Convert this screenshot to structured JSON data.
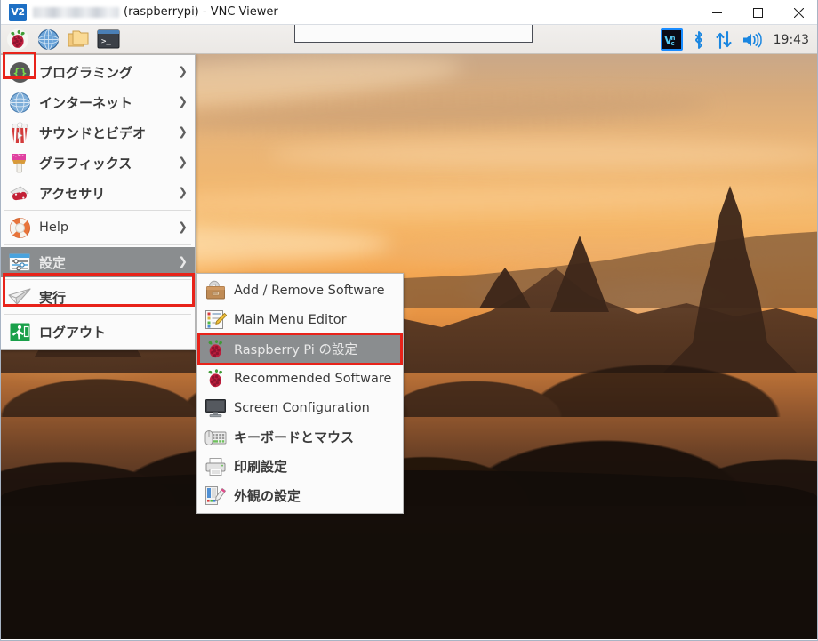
{
  "window": {
    "app_icon": "vnc-logo-icon",
    "app_icon_text": "V2",
    "host_redacted": "",
    "title": "(raspberrypi) - VNC Viewer",
    "minimize": "–",
    "maximize": "☐",
    "close": "×"
  },
  "taskbar": {
    "launchers": [
      {
        "name": "raspberry-menu-button",
        "icon": "raspberry-pi-icon"
      },
      {
        "name": "web-browser-button",
        "icon": "globe-icon"
      },
      {
        "name": "file-manager-button",
        "icon": "folders-icon"
      },
      {
        "name": "terminal-button",
        "icon": "terminal-icon"
      }
    ],
    "tray": [
      {
        "name": "vnc-server-tray-icon",
        "icon": "vnc-logo-icon",
        "label": "V2"
      },
      {
        "name": "bluetooth-tray-icon",
        "icon": "bluetooth-icon"
      },
      {
        "name": "network-tray-icon",
        "icon": "network-updown-icon"
      },
      {
        "name": "volume-tray-icon",
        "icon": "speaker-icon"
      }
    ],
    "clock": "19:43"
  },
  "menu": {
    "items": [
      {
        "label": "プログラミング",
        "icon": "braces-icon",
        "arrow": "❯",
        "lang": "ja",
        "selected": false
      },
      {
        "label": "インターネット",
        "icon": "globe-icon",
        "arrow": "❯",
        "lang": "ja",
        "selected": false
      },
      {
        "label": "サウンドとビデオ",
        "icon": "popcorn-icon",
        "arrow": "❯",
        "lang": "ja",
        "selected": false
      },
      {
        "label": "グラフィックス",
        "icon": "paintbrush-icon",
        "arrow": "❯",
        "lang": "ja",
        "selected": false
      },
      {
        "label": "アクセサリ",
        "icon": "swiss-knife-icon",
        "arrow": "❯",
        "lang": "ja",
        "selected": false
      },
      {
        "label": "Help",
        "icon": "lifebuoy-icon",
        "arrow": "❯",
        "lang": "en",
        "selected": false
      },
      {
        "label": "設定",
        "icon": "sliders-icon",
        "arrow": "❯",
        "lang": "ja",
        "selected": true
      },
      {
        "label": "実行",
        "icon": "paper-plane-icon",
        "arrow": "",
        "lang": "ja",
        "selected": false
      },
      {
        "label": "ログアウト",
        "icon": "exit-run-icon",
        "arrow": "",
        "lang": "ja",
        "selected": false
      }
    ]
  },
  "submenu": {
    "items": [
      {
        "label": "Add / Remove Software",
        "icon": "software-package-icon",
        "lang": "en",
        "selected": false
      },
      {
        "label": "Main Menu Editor",
        "icon": "menu-edit-icon",
        "lang": "en",
        "selected": false
      },
      {
        "label": "Raspberry Pi の設定",
        "icon": "raspberry-pi-icon",
        "lang": "mixed",
        "selected": true
      },
      {
        "label": "Recommended Software",
        "icon": "raspberry-pi-icon",
        "lang": "en",
        "selected": false
      },
      {
        "label": "Screen Configuration",
        "icon": "monitor-icon",
        "lang": "en",
        "selected": false
      },
      {
        "label": "キーボードとマウス",
        "icon": "keyboard-mouse-icon",
        "lang": "ja",
        "selected": false
      },
      {
        "label": "印刷設定",
        "icon": "printer-icon",
        "lang": "ja",
        "selected": false
      },
      {
        "label": "外観の設定",
        "icon": "appearance-palette-icon",
        "lang": "ja",
        "selected": false
      }
    ]
  },
  "annotations": {
    "accent_color": "#e8231a",
    "boxes": [
      {
        "name": "annotation-menu-button",
        "target": "raspberry-menu-button"
      },
      {
        "name": "annotation-settings-item",
        "target": "設定"
      },
      {
        "name": "annotation-raspi-config-item",
        "target": "Raspberry Pi の設定"
      }
    ]
  },
  "desktop": {
    "wallpaper_name": "bagan-temples-sunset",
    "highlight_color": "#8a8d8f"
  }
}
